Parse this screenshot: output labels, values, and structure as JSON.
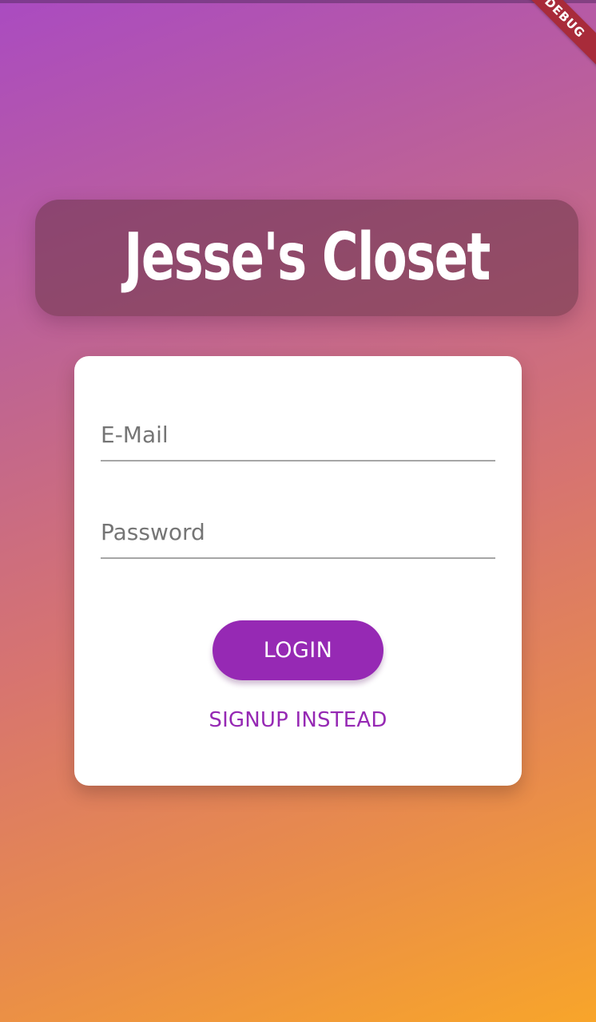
{
  "app": {
    "title": "Jesse's Closet",
    "debug_banner": "DEBUG"
  },
  "form": {
    "email_placeholder": "E-Mail",
    "email_value": "",
    "password_placeholder": "Password",
    "password_value": "",
    "login_label": "LOGIN",
    "signup_label": "SIGNUP INSTEAD"
  },
  "colors": {
    "gradient_start": "#aa4bc1",
    "gradient_end": "#f8a52a",
    "title_banner": "#6e374b",
    "card": "#ffffff",
    "accent": "#9629b4",
    "field_placeholder": "#757575",
    "field_underline": "#a6a6a6",
    "debug_banner": "#a82b3a"
  }
}
